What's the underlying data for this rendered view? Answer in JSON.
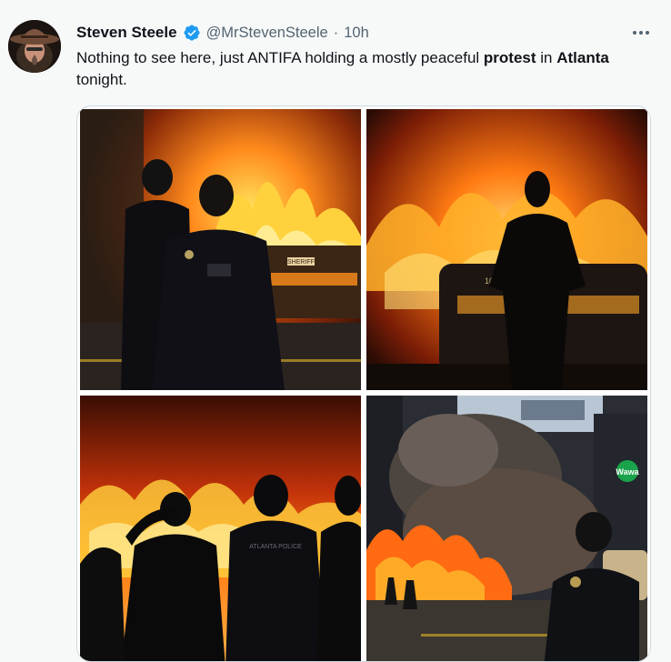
{
  "user": {
    "display_name": "Steven Steele",
    "handle": "@MrStevenSteele",
    "separator": "·",
    "time": "10h",
    "verified": true
  },
  "tweet": {
    "text_parts": [
      {
        "t": "Nothing to see here, just ANTIFA holding a mostly peaceful ",
        "b": false
      },
      {
        "t": "protest",
        "b": true
      },
      {
        "t": " in ",
        "b": false
      },
      {
        "t": "Atlanta",
        "b": true
      },
      {
        "t": " tonight.",
        "b": false
      }
    ]
  },
  "media": {
    "photos": [
      {
        "name": "photo-police-burning-car",
        "vehicle_text": "SHERIFF"
      },
      {
        "name": "photo-officer-silhouette-fire",
        "vehicle_text": "1070"
      },
      {
        "name": "photo-officers-watching-fire",
        "vest_text": "ATLANTA POLICE"
      },
      {
        "name": "photo-street-smoke",
        "sign_text": "Wawa"
      }
    ]
  },
  "colors": {
    "verified_blue": "#1d9bf0",
    "muted_text": "#536471",
    "fire_orange": "#ff7a12",
    "fire_yellow": "#ffd23d"
  }
}
